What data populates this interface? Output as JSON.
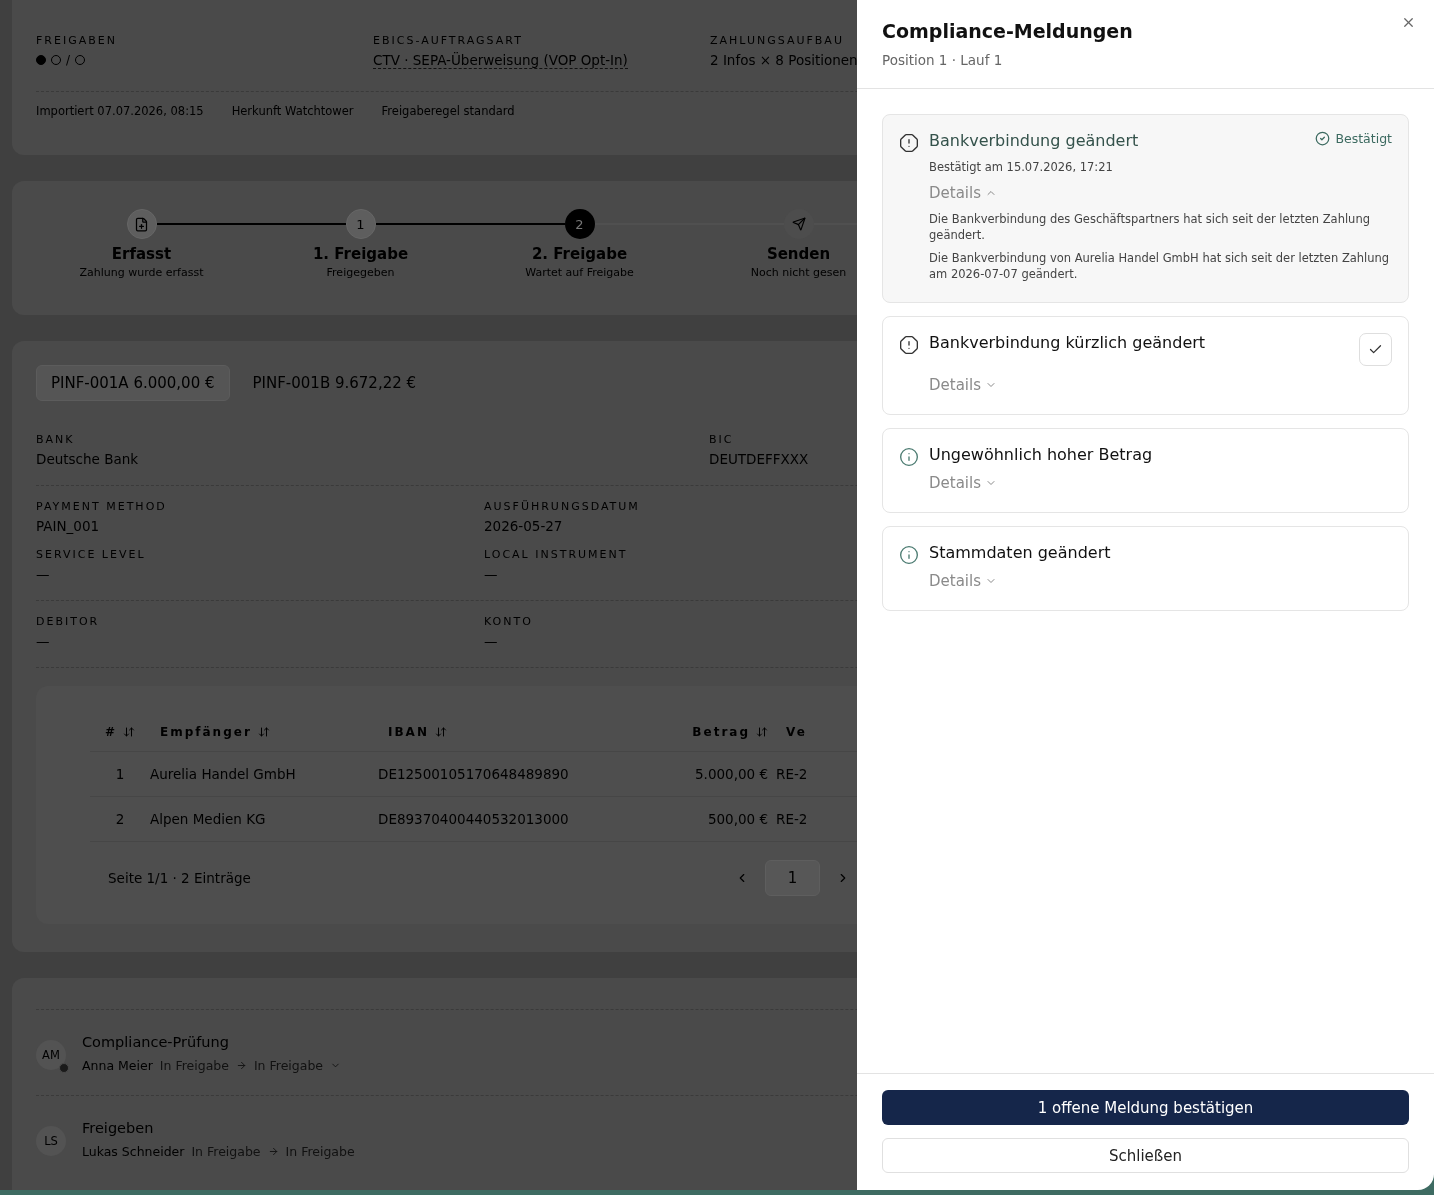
{
  "summary": {
    "approvals": {
      "label": "FREIGABEN",
      "marks": [
        {
          "kind": "dot",
          "done": true
        },
        {
          "kind": "dot",
          "done": false
        },
        {
          "kind": "separator",
          "text": "/"
        },
        {
          "kind": "dot",
          "done": false
        }
      ]
    },
    "fields": [
      {
        "label": "EBICS-AUFTRAGSART",
        "value": "CTV · SEPA-Überweisung (VOP Opt-In)",
        "underlined": true
      },
      {
        "label": "ZAHLUNGSAUFBAU",
        "value": "2 Infos × 8 Positionen",
        "underlined": false
      }
    ],
    "meta": [
      {
        "label": "Importiert",
        "value": "07.07.2026, 08:15"
      },
      {
        "label": "Herkunft",
        "value": "Watchtower"
      },
      {
        "label": "Freigaberegel",
        "value": "standard"
      }
    ]
  },
  "stepper": [
    {
      "kind": "file",
      "title": "Erfasst",
      "subtitle": "Zahlung wurde erfasst",
      "done": true,
      "current": false
    },
    {
      "kind": "number",
      "number": "1",
      "title": "1. Freigabe",
      "subtitle": "Freigegeben",
      "done": true,
      "current": false
    },
    {
      "kind": "number",
      "number": "2",
      "title": "2. Freigabe",
      "subtitle": "Wartet auf Freigabe",
      "done": false,
      "current": true
    },
    {
      "kind": "send",
      "title": "Senden",
      "subtitle": "Noch nicht gesen",
      "done": false,
      "current": false
    }
  ],
  "positions": [
    {
      "code": "PINF-001A",
      "amount": "6.000,00 €",
      "selected": true
    },
    {
      "code": "PINF-001B",
      "amount": "9.672,22 €",
      "selected": false
    }
  ],
  "field_sections": [
    {
      "kind": "wide",
      "fields": [
        {
          "label": "BANK",
          "value": "Deutsche Bank"
        },
        {
          "label": "BIC",
          "value": "DEUTDEFFXXX"
        }
      ]
    },
    {
      "kind": "narrow",
      "fields": [
        {
          "label": "PAYMENT METHOD",
          "value": "PAIN_001"
        },
        {
          "label": "AUSFÜHRUNGSDATUM",
          "value": "2026-05-27"
        },
        {
          "label": "SERVICE LEVEL",
          "value": "—"
        },
        {
          "label": "LOCAL INSTRUMENT",
          "value": "—"
        }
      ]
    },
    {
      "kind": "narrow",
      "fields": [
        {
          "label": "DEBITOR",
          "value": "—"
        },
        {
          "label": "KONTO",
          "value": "—"
        }
      ]
    }
  ],
  "table": {
    "columns": [
      {
        "label": "#",
        "sortable": true
      },
      {
        "label": "Empfänger",
        "sortable": true
      },
      {
        "label": "IBAN",
        "sortable": true
      },
      {
        "label": "Betrag",
        "sortable": true
      },
      {
        "label": "Ve",
        "sortable": false
      }
    ],
    "rows": [
      [
        "1",
        "Aurelia Handel GmbH",
        "DE12500105170648489890",
        "5.000,00 €",
        "RE-2"
      ],
      [
        "2",
        "Alpen Medien KG",
        "DE89370400440532013000",
        "500,00 €",
        "RE-2"
      ]
    ],
    "footer": "Seite 1/1 · 2 Einträge",
    "pages": [
      {
        "label": "1",
        "selected": true
      }
    ]
  },
  "history": [
    {
      "initials": "AM",
      "status_dot": true,
      "title": "Compliance-Prüfung",
      "user": "Anna Meier",
      "from": "In Freigabe",
      "to": "In Freigabe",
      "expandable": true
    },
    {
      "initials": "LS",
      "status_dot": false,
      "title": "Freigeben",
      "user": "Lukas Schneider",
      "from": "In Freigabe",
      "to": "In Freigabe",
      "expandable": false
    }
  ],
  "drawer": {
    "title": "Compliance-Meldungen",
    "subtitle": "Position 1 · Lauf 1",
    "messages": [
      {
        "kind": "confirmed",
        "title": "Bankverbindung geändert",
        "badge": "Bestätigt",
        "confirmed_at": "Bestätigt am 15.07.2026, 17:21",
        "details_label": "Details",
        "expanded": true,
        "details": [
          "Die Bankverbindung des Geschäftspartners hat sich seit der letzten Zahlung geändert.",
          "Die Bankverbindung von Aurelia Handel GmbH hat sich seit der letzten Zahlung am 2026-07-07 geändert."
        ]
      },
      {
        "kind": "open",
        "title": "Bankverbindung kürzlich geändert",
        "details_label": "Details",
        "expanded": false
      },
      {
        "kind": "info",
        "title": "Ungewöhnlich hoher Betrag",
        "details_label": "Details",
        "expanded": false
      },
      {
        "kind": "info",
        "title": "Stammdaten geändert",
        "details_label": "Details",
        "expanded": false
      }
    ],
    "primary_button": "1 offene Meldung bestätigen",
    "secondary_button": "Schließen"
  }
}
